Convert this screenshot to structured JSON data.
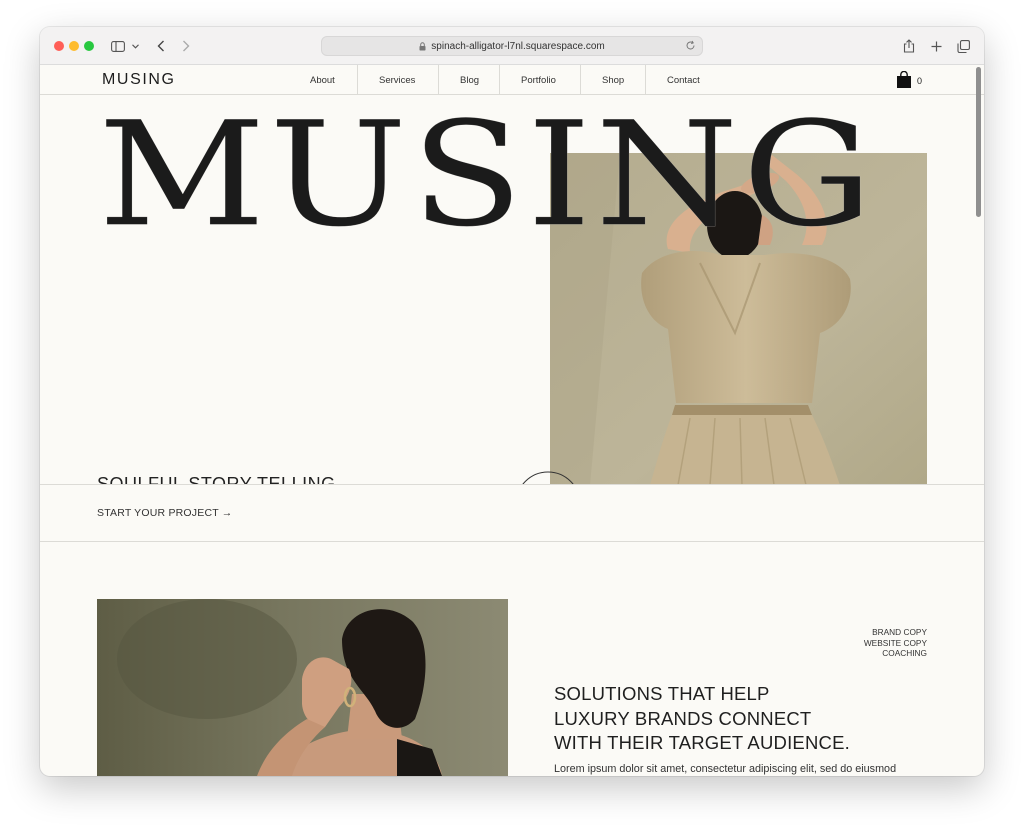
{
  "browser": {
    "url": "spinach-alligator-l7nl.squarespace.com"
  },
  "header": {
    "logo": "MUSING",
    "nav": [
      {
        "label": "About"
      },
      {
        "label": "Services"
      },
      {
        "label": "Blog"
      },
      {
        "label": "Portfolio"
      },
      {
        "label": "Shop"
      },
      {
        "label": "Contact"
      }
    ],
    "cart_count": "0"
  },
  "hero": {
    "title": "MUSING",
    "tagline": "SOULFUL STORY-TELLING",
    "cta": "START YOUR PROJECT →"
  },
  "intro": {
    "services": [
      "BRAND COPY",
      "WEBSITE COPY",
      "COACHING"
    ],
    "headline_lines": [
      "SOLUTIONS THAT HELP",
      "LUXURY BRANDS CONNECT",
      "WITH THEIR TARGET AUDIENCE."
    ],
    "body": "Lorem ipsum dolor sit amet, consectetur adipiscing elit, sed do eiusmod"
  },
  "colors": {
    "page_bg": "#fbfaf6",
    "photo_bg": "#b9b194",
    "dress": "#bfae8c"
  }
}
